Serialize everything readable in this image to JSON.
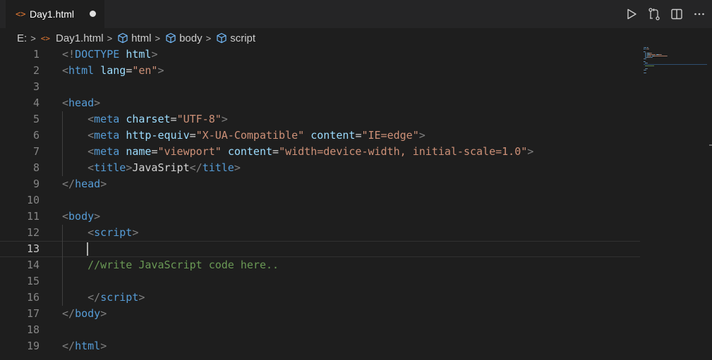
{
  "tab": {
    "label": "Day1.html",
    "file_icon": "<>",
    "dirty": true
  },
  "toolbar": {
    "icons": [
      "run-icon",
      "compare-changes-icon",
      "split-editor-icon",
      "more-actions-icon"
    ]
  },
  "breadcrumb": {
    "drive": "E:",
    "file": "Day1.html",
    "items": [
      "html",
      "body",
      "script"
    ]
  },
  "editor": {
    "current_line": 13,
    "lines": [
      {
        "n": "1",
        "tokens": [
          [
            "punct",
            "<!"
          ],
          [
            "doctype",
            "DOCTYPE"
          ],
          [
            "text",
            " "
          ],
          [
            "attr",
            "html"
          ],
          [
            "punct",
            ">"
          ]
        ]
      },
      {
        "n": "2",
        "tokens": [
          [
            "punct",
            "<"
          ],
          [
            "tag",
            "html"
          ],
          [
            "text",
            " "
          ],
          [
            "attr",
            "lang"
          ],
          [
            "text",
            "="
          ],
          [
            "str",
            "\"en\""
          ],
          [
            "punct",
            ">"
          ]
        ]
      },
      {
        "n": "3",
        "tokens": []
      },
      {
        "n": "4",
        "tokens": [
          [
            "punct",
            "<"
          ],
          [
            "tag",
            "head"
          ],
          [
            "punct",
            ">"
          ]
        ]
      },
      {
        "n": "5",
        "tokens": [
          [
            "text",
            "    "
          ],
          [
            "punct",
            "<"
          ],
          [
            "tag",
            "meta"
          ],
          [
            "text",
            " "
          ],
          [
            "attr",
            "charset"
          ],
          [
            "text",
            "="
          ],
          [
            "str",
            "\"UTF-8\""
          ],
          [
            "punct",
            ">"
          ]
        ]
      },
      {
        "n": "6",
        "tokens": [
          [
            "text",
            "    "
          ],
          [
            "punct",
            "<"
          ],
          [
            "tag",
            "meta"
          ],
          [
            "text",
            " "
          ],
          [
            "attr",
            "http-equiv"
          ],
          [
            "text",
            "="
          ],
          [
            "str",
            "\"X-UA-Compatible\""
          ],
          [
            "text",
            " "
          ],
          [
            "attr",
            "content"
          ],
          [
            "text",
            "="
          ],
          [
            "str",
            "\"IE=edge\""
          ],
          [
            "punct",
            ">"
          ]
        ]
      },
      {
        "n": "7",
        "tokens": [
          [
            "text",
            "    "
          ],
          [
            "punct",
            "<"
          ],
          [
            "tag",
            "meta"
          ],
          [
            "text",
            " "
          ],
          [
            "attr",
            "name"
          ],
          [
            "text",
            "="
          ],
          [
            "str",
            "\"viewport\""
          ],
          [
            "text",
            " "
          ],
          [
            "attr",
            "content"
          ],
          [
            "text",
            "="
          ],
          [
            "str",
            "\"width=device-width, initial-scale=1.0\""
          ],
          [
            "punct",
            ">"
          ]
        ]
      },
      {
        "n": "8",
        "tokens": [
          [
            "text",
            "    "
          ],
          [
            "punct",
            "<"
          ],
          [
            "tag",
            "title"
          ],
          [
            "punct",
            ">"
          ],
          [
            "text",
            "JavaSript"
          ],
          [
            "punct",
            "</"
          ],
          [
            "tag",
            "title"
          ],
          [
            "punct",
            ">"
          ]
        ]
      },
      {
        "n": "9",
        "tokens": [
          [
            "punct",
            "</"
          ],
          [
            "tag",
            "head"
          ],
          [
            "punct",
            ">"
          ]
        ]
      },
      {
        "n": "10",
        "tokens": []
      },
      {
        "n": "11",
        "tokens": [
          [
            "punct",
            "<"
          ],
          [
            "tag",
            "body"
          ],
          [
            "punct",
            ">"
          ]
        ]
      },
      {
        "n": "12",
        "tokens": [
          [
            "text",
            "    "
          ],
          [
            "punct",
            "<"
          ],
          [
            "tag",
            "script"
          ],
          [
            "punct",
            ">"
          ]
        ]
      },
      {
        "n": "13",
        "tokens": []
      },
      {
        "n": "14",
        "tokens": [
          [
            "text",
            "    "
          ],
          [
            "comment",
            "//write JavaScript code here.."
          ]
        ]
      },
      {
        "n": "15",
        "tokens": []
      },
      {
        "n": "16",
        "tokens": [
          [
            "text",
            "    "
          ],
          [
            "punct",
            "</"
          ],
          [
            "tag",
            "script"
          ],
          [
            "punct",
            ">"
          ]
        ]
      },
      {
        "n": "17",
        "tokens": [
          [
            "punct",
            "</"
          ],
          [
            "tag",
            "body"
          ],
          [
            "punct",
            ">"
          ]
        ]
      },
      {
        "n": "18",
        "tokens": []
      },
      {
        "n": "19",
        "tokens": [
          [
            "punct",
            "</"
          ],
          [
            "tag",
            "html"
          ],
          [
            "punct",
            ">"
          ]
        ]
      }
    ]
  },
  "colors": {
    "tag": "#569cd6",
    "attr": "#9cdcfe",
    "string": "#ce9178",
    "comment": "#6a9955",
    "punct": "#808080",
    "file_icon": "#e37933"
  }
}
